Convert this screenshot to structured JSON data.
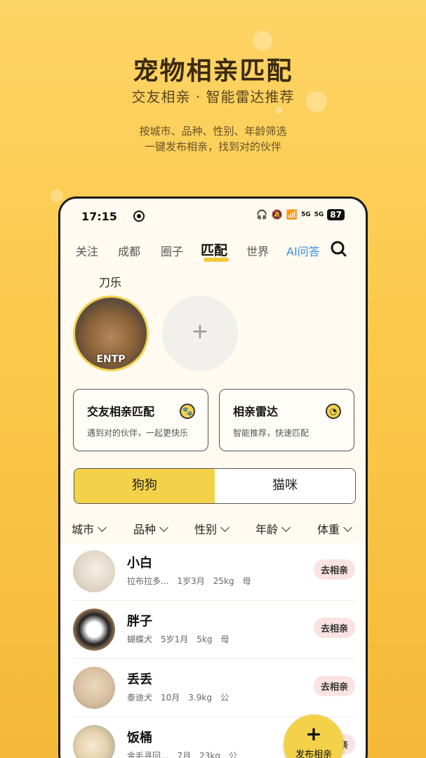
{
  "hero": {
    "title": "宠物相亲匹配",
    "subtitle": "交友相亲 · 智能雷达推荐",
    "desc_line1": "按城市、品种、性别、年龄筛选",
    "desc_line2": "一键发布相亲，找到对的伙伴"
  },
  "status_bar": {
    "time": "17:15",
    "network_1": "5G",
    "network_2": "5G",
    "battery": "87"
  },
  "nav": {
    "tabs": [
      "关注",
      "成都",
      "圈子",
      "匹配",
      "世界",
      "AI问答"
    ],
    "active_tab": "匹配",
    "search_icon": "search-icon"
  },
  "my_pet": {
    "name": "刀乐",
    "mbti": "ENTP",
    "add_label": "+"
  },
  "cards": [
    {
      "title": "交友相亲匹配",
      "desc": "遇到对的伙伴，一起更快乐",
      "icon": "paw-icon"
    },
    {
      "title": "相亲雷达",
      "desc": "智能推荐，快速匹配",
      "icon": "radar-icon"
    }
  ],
  "segment": {
    "options": [
      "狗狗",
      "猫咪"
    ],
    "selected": "狗狗",
    "selected_color": "#f3d24a"
  },
  "filters": [
    "城市",
    "品种",
    "性别",
    "年龄",
    "体重"
  ],
  "pets": [
    {
      "name": "小白",
      "breed": "拉布拉多...",
      "age": "1岁3月",
      "weight": "25kg",
      "gender": "母",
      "action": "去相亲"
    },
    {
      "name": "胖子",
      "breed": "蝴蝶犬",
      "age": "5岁1月",
      "weight": "5kg",
      "gender": "母",
      "action": "去相亲"
    },
    {
      "name": "丢丢",
      "breed": "泰迪犬",
      "age": "10月",
      "weight": "3.9kg",
      "gender": "公",
      "action": "去相亲"
    },
    {
      "name": "饭桶",
      "breed": "金毛寻回...",
      "age": "7月",
      "weight": "23kg",
      "gender": "公",
      "action": "去相亲"
    }
  ],
  "publish": {
    "icon": "+",
    "label": "发布相亲"
  },
  "colors": {
    "accent": "#f3d24a",
    "ai_blue": "#3a8ee6",
    "action_bg": "#fbe3e3"
  }
}
